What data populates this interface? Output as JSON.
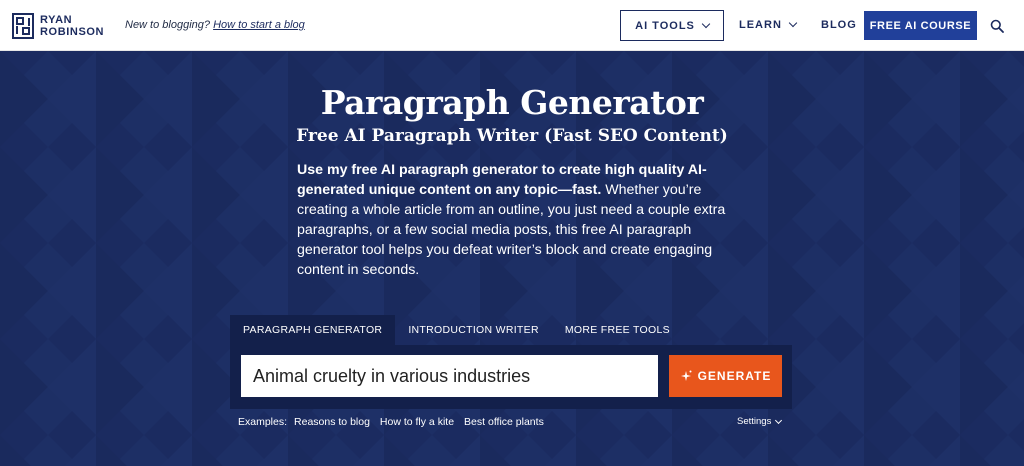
{
  "header": {
    "logo_line1": "RYAN",
    "logo_line2": "ROBINSON",
    "tagline_prefix": "New to blogging?",
    "tagline_link": "How to start a blog",
    "nav": {
      "ai_tools": "AI TOOLS",
      "learn": "LEARN",
      "blog": "BLOG",
      "free_course": "FREE AI COURSE"
    },
    "search_icon": "search-icon"
  },
  "hero": {
    "title": "Paragraph Generator",
    "subtitle": "Free AI Paragraph Writer (Fast SEO Content)",
    "intro_bold": "Use my free AI paragraph generator to create high quality AI-generated unique content on any topic—fast.",
    "intro_rest": " Whether you’re creating a whole article from an outline, you just need a couple extra paragraphs, or a few social media posts, this free AI paragraph generator tool helps you defeat writer’s block and create engaging content in seconds."
  },
  "tool": {
    "tabs": [
      "PARAGRAPH GENERATOR",
      "INTRODUCTION WRITER",
      "MORE FREE TOOLS"
    ],
    "active_tab": "PARAGRAPH GENERATOR",
    "input_value": "Animal cruelty in various industries",
    "generate_label": "GENERATE",
    "generate_icon": "sparkle-icon",
    "examples_label": "Examples:",
    "examples": [
      "Reasons to blog",
      "How to fly a kite",
      "Best office plants"
    ],
    "settings_label": "Settings"
  },
  "colors": {
    "brand_navy": "#1c2b5e",
    "hero_bg": "#1b2b60",
    "course_button": "#21409a",
    "generate_button": "#e8561c"
  }
}
